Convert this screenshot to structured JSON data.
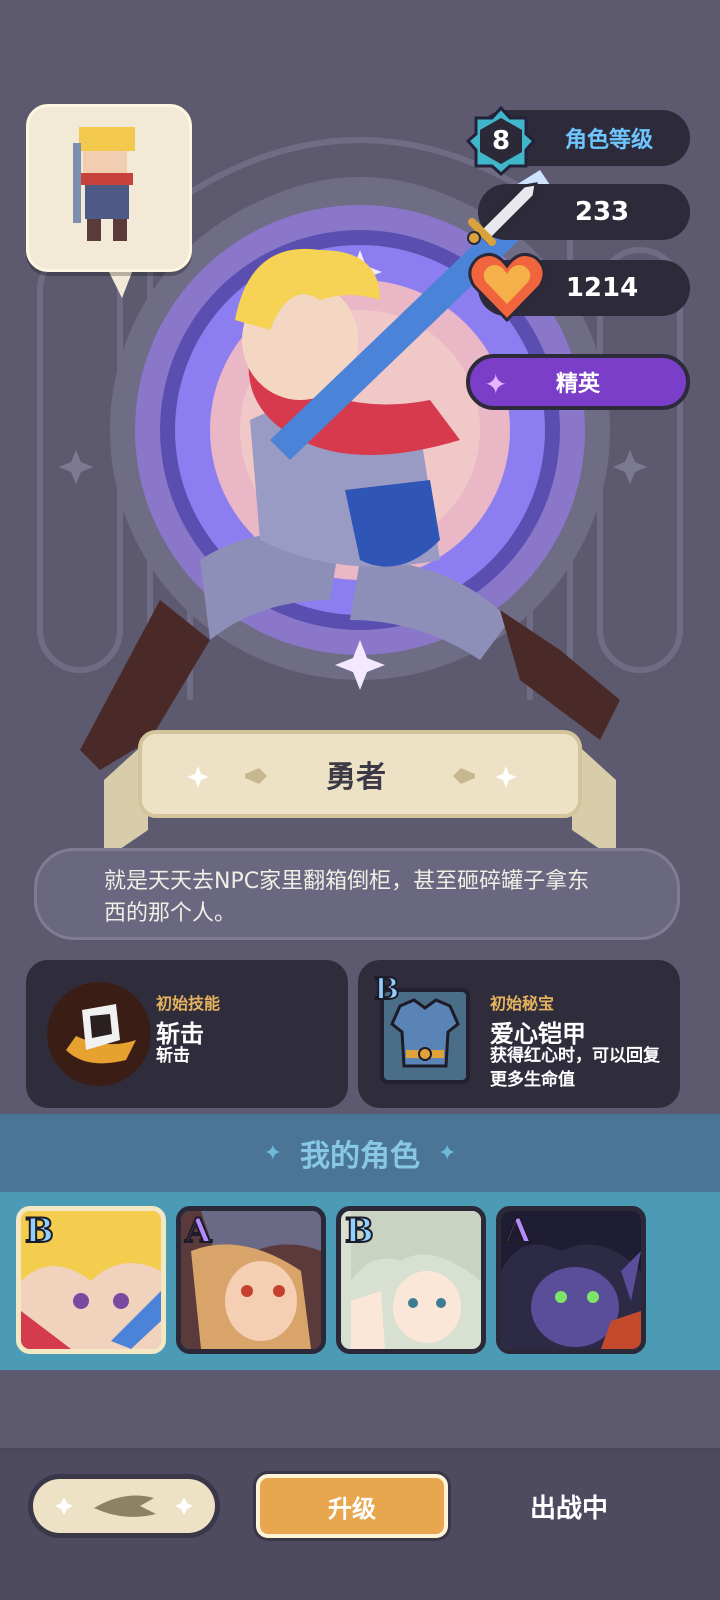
{
  "character": {
    "name": "勇者",
    "description": "就是天天去NPC家里翻箱倒柜，甚至砸碎罐子拿东西的那个人。",
    "rarity": "精英"
  },
  "stats": {
    "level_value": "8",
    "level_label": "角色等级",
    "attack_value": "233",
    "hp_value": "1214"
  },
  "skill_card": {
    "label": "初始技能",
    "title": "斩击",
    "desc": "斩击"
  },
  "treasure_card": {
    "label": "初始秘宝",
    "grade": "B",
    "title": "爱心铠甲",
    "desc": "获得红心时，可以回复更多生命值"
  },
  "my_characters": {
    "title": "我的角色",
    "slots": [
      {
        "grade": "B",
        "selected": true
      },
      {
        "grade": "A",
        "selected": false
      },
      {
        "grade": "B",
        "selected": false
      },
      {
        "grade": "A",
        "selected": false
      }
    ]
  },
  "bottom": {
    "upgrade_label": "升级",
    "status_label": "出战中"
  },
  "colors": {
    "background": "#5d5a70",
    "accent_gold": "#e8a64e",
    "elite_purple": "#7b3ec8",
    "level_cyan": "#6fc6ff",
    "team_strip": "#4b9ab6"
  },
  "icons": [
    "level-hexagon-icon",
    "sword-icon",
    "heart-icon",
    "sparkle-icon",
    "sword-slash-skill-icon",
    "armor-icon",
    "arrow-left-icon"
  ]
}
